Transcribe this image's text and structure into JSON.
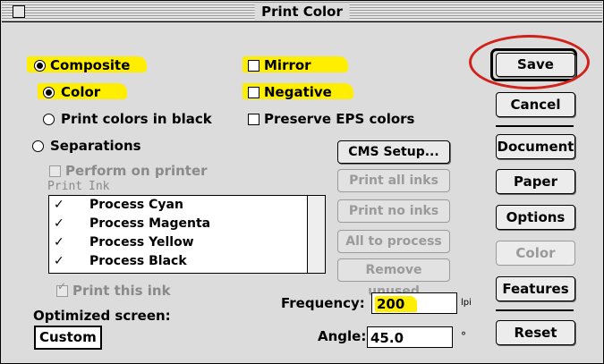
{
  "window": {
    "title": "Print Color"
  },
  "output": {
    "composite_label": "Composite",
    "color_label": "Color",
    "print_colors_in_black_label": "Print colors in black",
    "separations_label": "Separations",
    "perform_on_printer_label": "Perform on printer"
  },
  "options": {
    "mirror_label": "Mirror",
    "negative_label": "Negative",
    "preserve_eps_label": "Preserve EPS colors"
  },
  "ink_list": {
    "header_print": "Print",
    "header_ink": "Ink",
    "items": [
      {
        "check": "✓",
        "name": "Process Cyan"
      },
      {
        "check": "✓",
        "name": "Process Magenta"
      },
      {
        "check": "✓",
        "name": "Process Yellow"
      },
      {
        "check": "✓",
        "name": "Process Black"
      }
    ],
    "print_this_ink_label": "Print this ink"
  },
  "ink_buttons": {
    "cms_setup": "CMS Setup...",
    "print_all_inks": "Print all inks",
    "print_no_inks": "Print no inks",
    "all_to_process": "All to process",
    "remove_unused": "Remove unused"
  },
  "screen": {
    "optimized_label": "Optimized screen:",
    "optimized_value": "Custom",
    "frequency_label": "Frequency:",
    "frequency_value": "200",
    "frequency_unit": "lpi",
    "angle_label": "Angle:",
    "angle_value": "45.0",
    "angle_unit": "°"
  },
  "buttons": {
    "save": "Save",
    "cancel": "Cancel",
    "document": "Document",
    "paper": "Paper",
    "options": "Options",
    "color": "Color",
    "features": "Features",
    "reset": "Reset"
  },
  "colors": {
    "highlight": "#ffee00",
    "annotation_ring": "#d0211a",
    "dialog_bg": "#dcdcdc"
  }
}
